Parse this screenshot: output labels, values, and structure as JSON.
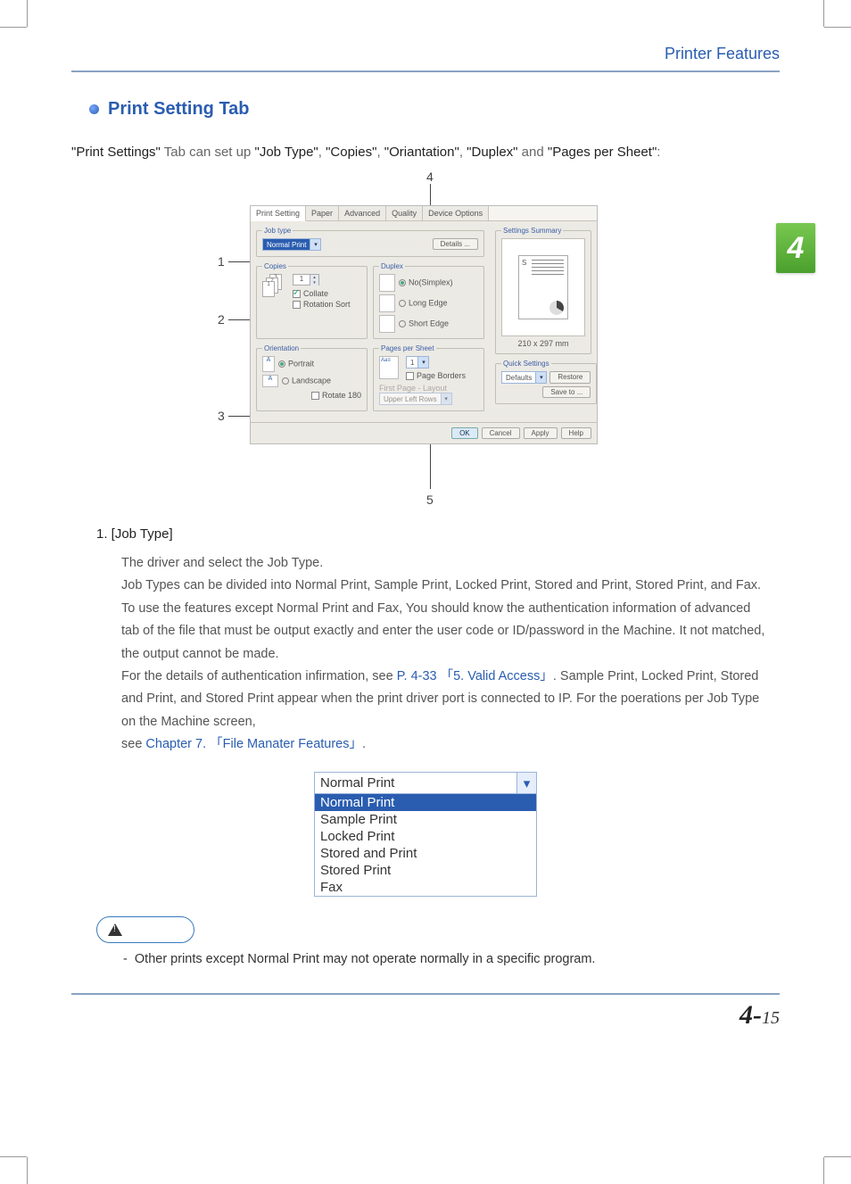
{
  "header": {
    "running": "Printer Features",
    "chapter_tab": "4"
  },
  "heading": "Print Setting Tab",
  "intro": {
    "pre": "\"Print Settings\"",
    "mid1": " Tab can set up ",
    "kw1": "\"Job Type\"",
    "sep": ", ",
    "kw2": "\"Copies\"",
    "kw3": "\"Oriantation\"",
    "kw4": "\"Duplex\"",
    "and": " and ",
    "kw5": "\"Pages per Sheet\"",
    "tail": ":"
  },
  "callouts": {
    "c1": "1",
    "c2": "2",
    "c3": "3",
    "c4": "4",
    "c5": "5"
  },
  "dialog": {
    "tabs": [
      "Print Setting",
      "Paper",
      "Advanced",
      "Quality",
      "Device Options"
    ],
    "jobtype": {
      "legend": "Job type",
      "value": "Normal Print",
      "details": "Details ..."
    },
    "copies": {
      "legend": "Copies",
      "count": "1",
      "collate": "Collate",
      "rotation": "Rotation Sort"
    },
    "orientation": {
      "legend": "Orientation",
      "portrait": "Portrait",
      "landscape": "Landscape",
      "rotate180": "Rotate 180"
    },
    "duplex": {
      "legend": "Duplex",
      "none": "No(Simplex)",
      "long": "Long Edge",
      "short": "Short Edge"
    },
    "pps": {
      "legend": "Pages per Sheet",
      "value": "1",
      "borders": "Page Borders",
      "layout_label": "First Page - Layout",
      "layout_value": "Upper Left  Rows"
    },
    "summary": {
      "legend": "Settings Summary",
      "dim": "210 x 297 mm"
    },
    "quick": {
      "legend": "Quick Settings",
      "value": "Defaults",
      "restore": "Restore",
      "saveto": "Save to ..."
    },
    "buttons": {
      "ok": "OK",
      "cancel": "Cancel",
      "apply": "Apply",
      "help": "Help"
    }
  },
  "section1": {
    "title": "1. [Job Type]",
    "p1": "The driver and select the Job Type.",
    "p2": "Job Types can be divided into Normal Print, Sample Print, Locked Print, Stored and Print, Stored Print, and Fax. To use the features except Normal Print and Fax, You should know the authentication information of advanced tab of the file that must be output exactly and enter the user code or ID/password in the Machine. It not matched, the output cannot be made.",
    "p3a": "For the details of authentication infirmation, see ",
    "link1": "P. 4-33 「5. Valid Access」",
    "p3b": ". Sample Print, Locked Print, Stored and Print, and Stored Print appear when the print driver port is connected to IP. For the poerations per Job Type on the Machine screen,",
    "p4a": "see ",
    "link2": "Chapter 7. 「File Manater Features」",
    "p4b": "."
  },
  "dropdown": {
    "selected": "Normal Print",
    "items": [
      "Normal Print",
      "Sample Print",
      "Locked Print",
      "Stored and Print",
      "Stored Print",
      "Fax"
    ]
  },
  "caution": {
    "text": "Other prints except Normal Print may not operate normally in a specific program."
  },
  "pagefoot": {
    "chapter": "4-",
    "page": "15"
  }
}
